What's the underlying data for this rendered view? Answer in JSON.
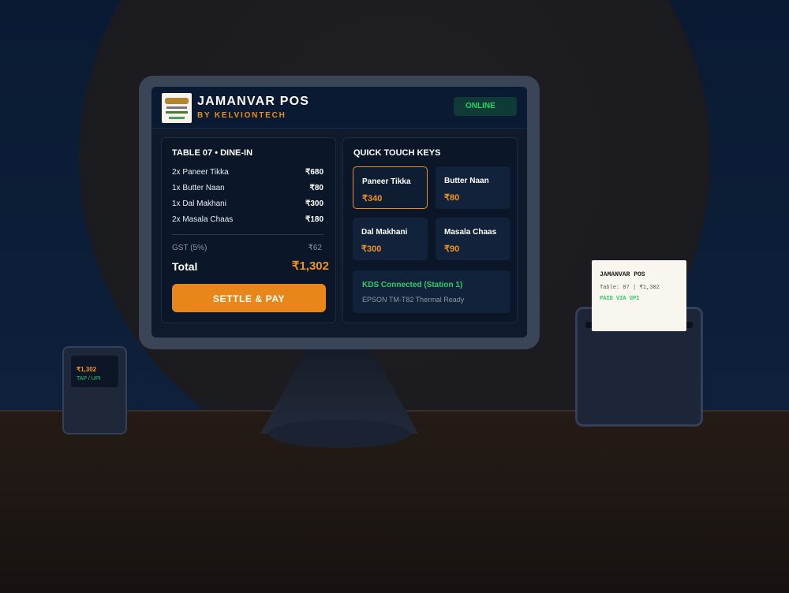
{
  "colors": {
    "accent": "#e8861a",
    "success": "#25d366",
    "screen_bg": "#0f1b2d",
    "panel_bg": "#0b1729"
  },
  "header": {
    "title": "JAMANVAR POS",
    "subtitle": "BY KELVIONTECH",
    "status": "ONLINE",
    "logo_icon": "restaurant-logo-icon"
  },
  "order": {
    "title": "TABLE 07 • DINE-IN",
    "items": [
      {
        "name": "2x Paneer Tikka",
        "price": "₹680"
      },
      {
        "name": "1x Butter Naan",
        "price": "₹80"
      },
      {
        "name": "1x Dal Makhani",
        "price": "₹300"
      },
      {
        "name": "2x Masala Chaas",
        "price": "₹180"
      }
    ],
    "gst_label": "GST (5%)",
    "gst_value": "₹62",
    "total_label": "Total",
    "total_value": "₹1,302",
    "settle_label": "SETTLE & PAY"
  },
  "keys": {
    "title": "QUICK TOUCH KEYS",
    "items": [
      {
        "name": "Paneer Tikka",
        "price": "₹340",
        "selected": true
      },
      {
        "name": "Butter Naan",
        "price": "₹80",
        "selected": false
      },
      {
        "name": "Dal Makhani",
        "price": "₹300",
        "selected": false
      },
      {
        "name": "Masala Chaas",
        "price": "₹90",
        "selected": false
      }
    ],
    "kds_title": "KDS Connected (Station 1)",
    "kds_sub": "EPSON TM-T82 Thermal Ready"
  },
  "terminal": {
    "amount": "₹1,302",
    "method": "TAP / UPI"
  },
  "receipt": {
    "title": "JAMANVAR POS",
    "line": "Table: 07 | ₹1,302",
    "status": "PAID VIA UPI"
  }
}
